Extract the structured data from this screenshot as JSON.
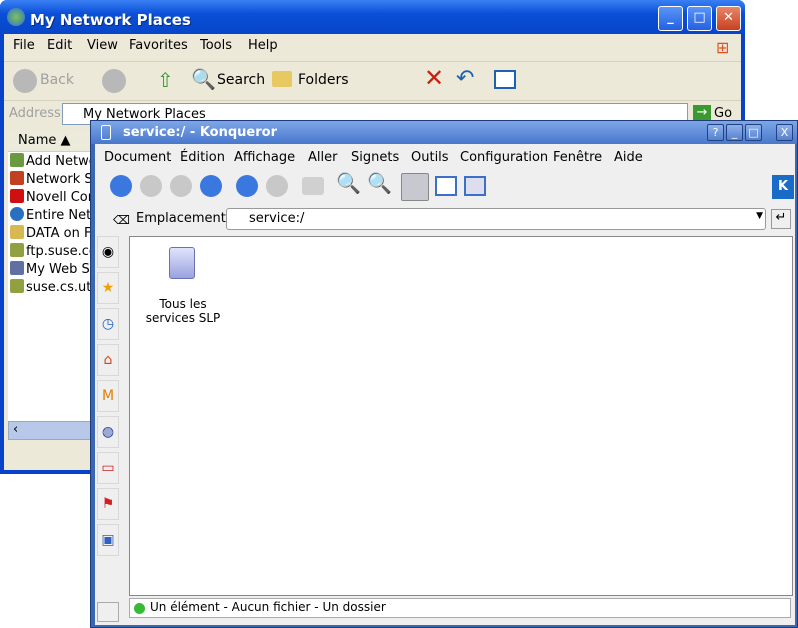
{
  "xp": {
    "title": "My Network Places",
    "menu": [
      "File",
      "Edit",
      "View",
      "Favorites",
      "Tools",
      "Help"
    ],
    "toolbar": {
      "back": "Back",
      "search": "Search",
      "folders": "Folders"
    },
    "address_label": "Address",
    "address_value": "My Network Places",
    "go": "Go",
    "column": "Name",
    "items": [
      "Add Network Place",
      "Network Setup Wizard",
      "Novell Connections",
      "Entire Network",
      "DATA on F",
      "ftp.suse.com",
      "My Web Sites",
      "suse.cs.utah"
    ]
  },
  "konqueror": {
    "title": "service:/ - Konqueror",
    "title_buttons": [
      "?",
      "_",
      "□",
      "X"
    ],
    "menu": [
      "Document",
      "Édition",
      "Affichage",
      "Aller",
      "Signets",
      "Outils",
      "Configuration",
      "Fenêtre",
      "Aide"
    ],
    "location_label": "Emplacement :",
    "location_value": "service:/",
    "file_icon_label": "Tous les services SLP",
    "status": "Un élément - Aucun fichier - Un dossier"
  }
}
